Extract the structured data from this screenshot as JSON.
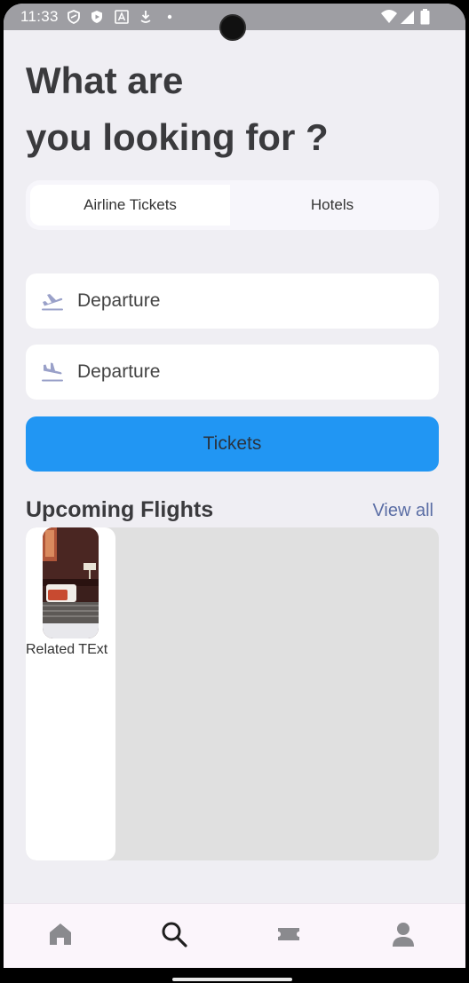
{
  "status_bar": {
    "time": "11:33",
    "left_icons": [
      "shield-icon",
      "play-shield-icon",
      "font-a-icon",
      "download-icon",
      "dot-icon"
    ],
    "right_icons": [
      "wifi-icon",
      "signal-icon",
      "battery-icon"
    ]
  },
  "header": {
    "title_line1": "What are",
    "title_line2": "you looking for ?"
  },
  "segment": {
    "options": [
      "Airline Tickets",
      "Hotels"
    ],
    "selected": "Airline Tickets"
  },
  "form": {
    "field1_label": "Departure",
    "field1_icon": "airplane-takeoff-icon",
    "field2_label": "Departure",
    "field2_icon": "airplane-landing-icon",
    "submit_label": "Tickets"
  },
  "upcoming": {
    "title": "Upcoming Flights",
    "view_all": "View all",
    "cards": [
      {
        "label": "Related TExt",
        "image": "hotel-room-photo"
      }
    ]
  },
  "bottom_nav": {
    "items": [
      "home-icon",
      "search-icon",
      "ticket-icon",
      "person-icon"
    ],
    "active": "search-icon"
  },
  "colors": {
    "background": "#efeef3",
    "accent": "#2196f3",
    "link": "#5b6ea5",
    "status_bar": "#9e9ea3"
  }
}
